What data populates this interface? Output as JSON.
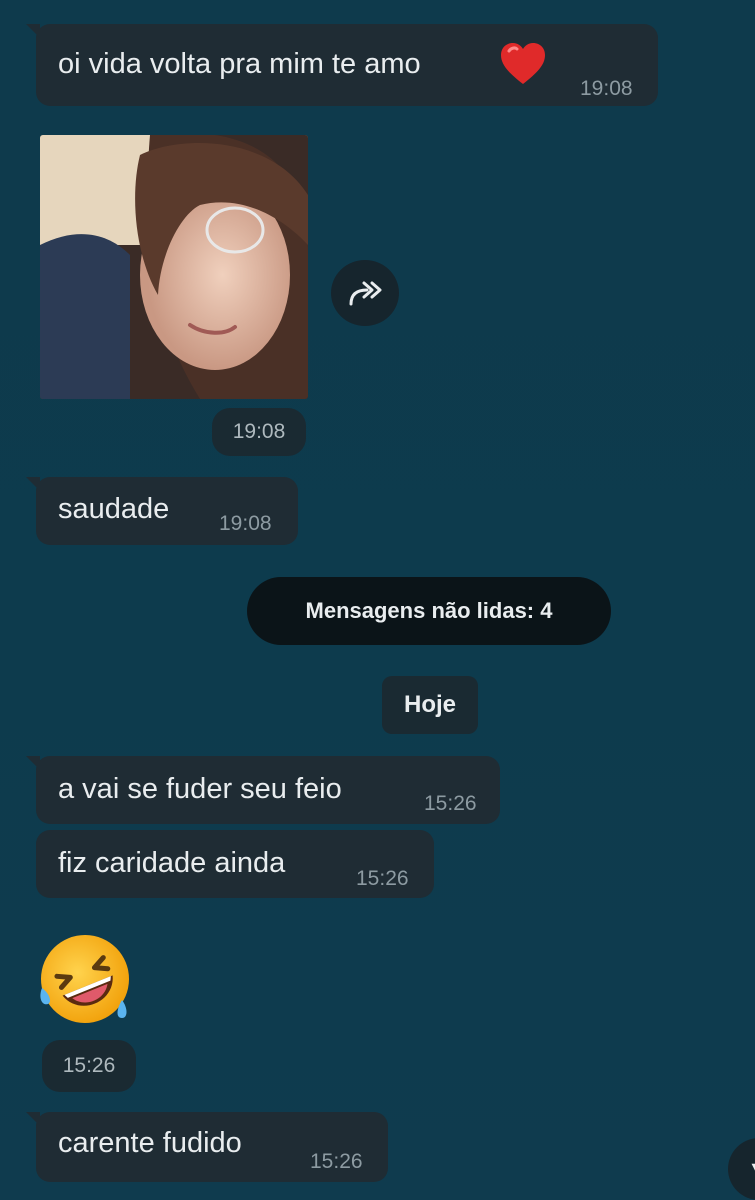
{
  "messages": {
    "m1": {
      "text": "oi vida volta pra mim te amo",
      "emoji": "❤️",
      "time": "19:08"
    },
    "m2": {
      "time": "19:08"
    },
    "m3": {
      "text": "saudade",
      "time": "19:08"
    },
    "m4": {
      "text": "a vai se fuder seu feio",
      "time": "15:26"
    },
    "m5": {
      "text": "fiz caridade ainda",
      "time": "15:26"
    },
    "m6": {
      "emoji": "🤣",
      "time": "15:26"
    },
    "m7": {
      "text": "carente fudido",
      "time": "15:26"
    }
  },
  "system": {
    "unread": "Mensagens não lidas: 4",
    "date_chip": "Hoje"
  },
  "icons": {
    "forward": "forward-icon",
    "heart": "heart-icon",
    "laughing": "rolling-on-floor-laughing-icon"
  },
  "colors": {
    "background": "#0e3a4c",
    "bubble": "#1f2c34",
    "time": "#8d9ba2",
    "system_pill": "#0b1418"
  }
}
